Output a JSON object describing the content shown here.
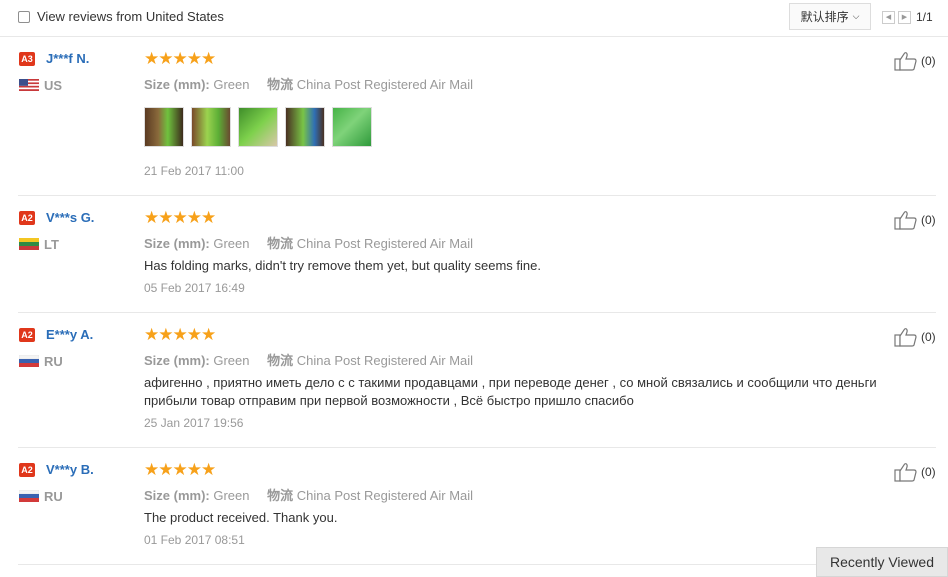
{
  "filter": {
    "label": "View reviews from United States",
    "checked": false
  },
  "sort": {
    "label": "默认排序"
  },
  "pager": {
    "page": "1/1"
  },
  "reviews": [
    {
      "badge": "A3",
      "user": "J***f N.",
      "country": "US",
      "flag": "us-flag",
      "stars": "★★★★★",
      "size_label": "Size (mm):",
      "size_value": "Green",
      "ship_label": "物流",
      "ship_value": "China Post Registered Air Mail",
      "text": "",
      "date": "21 Feb 2017 11:00",
      "helpful": "(0)",
      "photos": [
        "photo-1",
        "photo-2",
        "photo-3",
        "photo-4",
        "photo-5"
      ]
    },
    {
      "badge": "A2",
      "user": "V***s G.",
      "country": "LT",
      "flag": "lt-flag",
      "stars": "★★★★★",
      "size_label": "Size (mm):",
      "size_value": "Green",
      "ship_label": "物流",
      "ship_value": "China Post Registered Air Mail",
      "text": "Has folding marks, didn't try remove them yet, but quality seems fine.",
      "date": "05 Feb 2017 16:49",
      "helpful": "(0)"
    },
    {
      "badge": "A2",
      "user": "E***y A.",
      "country": "RU",
      "flag": "ru-flag",
      "stars": "★★★★★",
      "size_label": "Size (mm):",
      "size_value": "Green",
      "ship_label": "物流",
      "ship_value": "China Post Registered Air Mail",
      "text_line1": "афигенно , приятно иметь дело с с такими продавцами , при переводе денег , со мной связались и сообщили что деньги",
      "text_line2": "прибыли товар отправим при первой возможности , Всё быстро пришло спасибо",
      "date": "25 Jan 2017 19:56",
      "helpful": "(0)"
    },
    {
      "badge": "A2",
      "user": "V***y B.",
      "country": "RU",
      "flag": "ru-flag",
      "stars": "★★★★★",
      "size_label": "Size (mm):",
      "size_value": "Green",
      "ship_label": "物流",
      "ship_value": "China Post Registered Air Mail",
      "text": "The product received. Thank you.",
      "date": "01 Feb 2017 08:51",
      "helpful": "(0)"
    }
  ],
  "recently_viewed": "Recently Viewed",
  "colors": {
    "accent_blue": "#2a6db8",
    "star": "#f7a11a",
    "badge": "#e0371b",
    "muted": "#999999"
  }
}
